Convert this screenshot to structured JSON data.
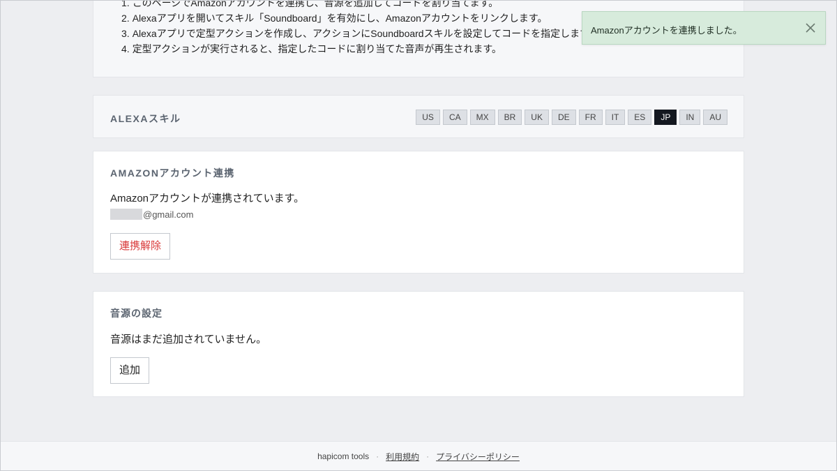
{
  "intro": {
    "steps": [
      {
        "num": "1.",
        "text": "このページでAmazonアカウントを連携し、音源を追加してコードを割り当てます。"
      },
      {
        "num": "2.",
        "text": "Alexaアプリを開いてスキル「Soundboard」を有効にし、Amazonアカウントをリンクします。"
      },
      {
        "num": "3.",
        "text": "Alexaアプリで定型アクションを作成し、アクションにSoundboardスキルを設定してコードを指定します。"
      },
      {
        "num": "4.",
        "text": "定型アクションが実行されると、指定したコードに割り当てた音声が再生されます。"
      }
    ]
  },
  "skill": {
    "title": "ALEXAスキル",
    "regions": [
      "US",
      "CA",
      "MX",
      "BR",
      "UK",
      "DE",
      "FR",
      "IT",
      "ES",
      "JP",
      "IN",
      "AU"
    ],
    "active_region": "JP"
  },
  "amazon": {
    "title": "AMAZONアカウント連携",
    "status_text": "Amazonアカウントが連携されています。",
    "email_domain": "@gmail.com",
    "unlink_label": "連携解除"
  },
  "sound": {
    "title": "音源の設定",
    "empty_text": "音源はまだ追加されていません。",
    "add_label": "追加"
  },
  "footer": {
    "brand": "hapicom tools",
    "separator": "·",
    "terms": "利用規約",
    "privacy": "プライバシーポリシー"
  },
  "toast": {
    "message": "Amazonアカウントを連携しました。",
    "close_icon": "close-icon"
  },
  "colors": {
    "page_bg": "#edeef1",
    "active_region": "#141820",
    "danger": "#d93a3a",
    "toast_bg": "#d7ebdc"
  }
}
